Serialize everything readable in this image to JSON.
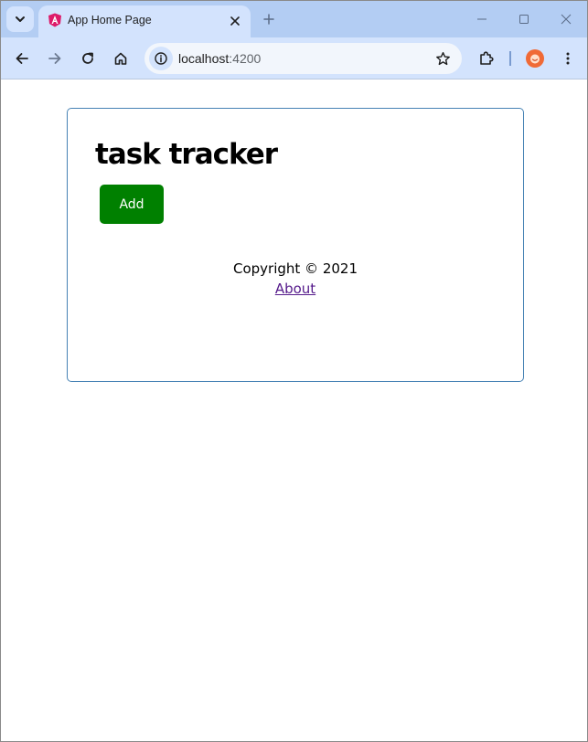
{
  "tab": {
    "title": "App Home Page",
    "favicon": "angular-icon"
  },
  "omnibox": {
    "host": "localhost",
    "port": ":4200"
  },
  "page": {
    "heading": "task tracker",
    "add_label": "Add",
    "copyright": "Copyright © 2021",
    "about_label": "About"
  },
  "colors": {
    "add_button": "#008000",
    "card_border": "#4682b4",
    "link": "#551a8b",
    "tabstrip": "#b3cdf3",
    "toolbar": "#d3e3fd"
  }
}
